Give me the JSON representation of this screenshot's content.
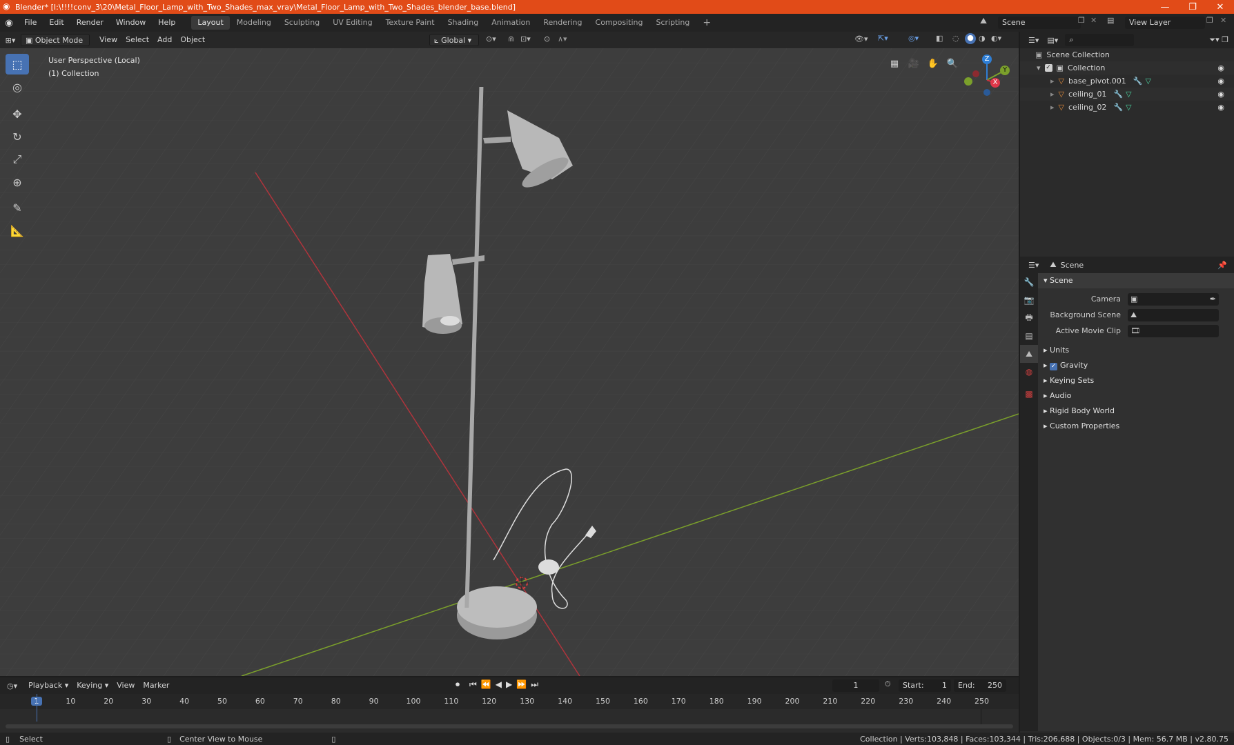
{
  "window": {
    "title": "Blender* [I:\\!!!!conv_3\\20\\Metal_Floor_Lamp_with_Two_Shades_max_vray\\Metal_Floor_Lamp_with_Two_Shades_blender_base.blend]"
  },
  "menu": [
    "File",
    "Edit",
    "Render",
    "Window",
    "Help"
  ],
  "workspaces": [
    "Layout",
    "Modeling",
    "Sculpting",
    "UV Editing",
    "Texture Paint",
    "Shading",
    "Animation",
    "Rendering",
    "Compositing",
    "Scripting"
  ],
  "workspace_add": "+",
  "scene_field": "Scene",
  "view_layer_field": "View Layer",
  "viewport_header": {
    "mode": "Object Mode",
    "menus": [
      "View",
      "Select",
      "Add",
      "Object"
    ],
    "orientation": "Global"
  },
  "viewport": {
    "perspective": "User Perspective (Local)",
    "collection": "(1) Collection",
    "gizmo": {
      "x": "X",
      "y": "Y",
      "z": "Z"
    }
  },
  "outliner": {
    "root": "Scene Collection",
    "collection": "Collection",
    "objects": [
      "base_pivot.001",
      "ceiling_01",
      "ceiling_02"
    ]
  },
  "properties": {
    "header": "Scene",
    "section": "Scene",
    "fields": [
      {
        "label": "Camera",
        "value": ""
      },
      {
        "label": "Background Scene",
        "value": ""
      },
      {
        "label": "Active Movie Clip",
        "value": ""
      }
    ],
    "subsections": [
      "Units",
      "Gravity",
      "Keying Sets",
      "Audio",
      "Rigid Body World",
      "Custom Properties"
    ],
    "gravity_checked": true
  },
  "timeline": {
    "menus": [
      "Playback",
      "Keying",
      "View",
      "Marker"
    ],
    "current_frame": "1",
    "start_label": "Start:",
    "start": "1",
    "end_label": "End:",
    "end": "250",
    "ticks": [
      "1",
      "10",
      "20",
      "30",
      "40",
      "50",
      "60",
      "70",
      "80",
      "90",
      "100",
      "110",
      "120",
      "130",
      "140",
      "150",
      "160",
      "170",
      "180",
      "190",
      "200",
      "210",
      "220",
      "230",
      "240",
      "250"
    ]
  },
  "status": {
    "left": "Select",
    "middle": "Center View to Mouse",
    "right": "Collection | Verts:103,848 | Faces:103,344 | Tris:206,688 | Objects:0/3 | Mem: 56.7 MB | v2.80.75"
  },
  "colors": {
    "title_bar": "#e14b18",
    "accent_blue": "#4772b3",
    "axis_x": "#c8343e",
    "axis_y": "#7ba02b",
    "axis_z": "#2f7fd6"
  }
}
